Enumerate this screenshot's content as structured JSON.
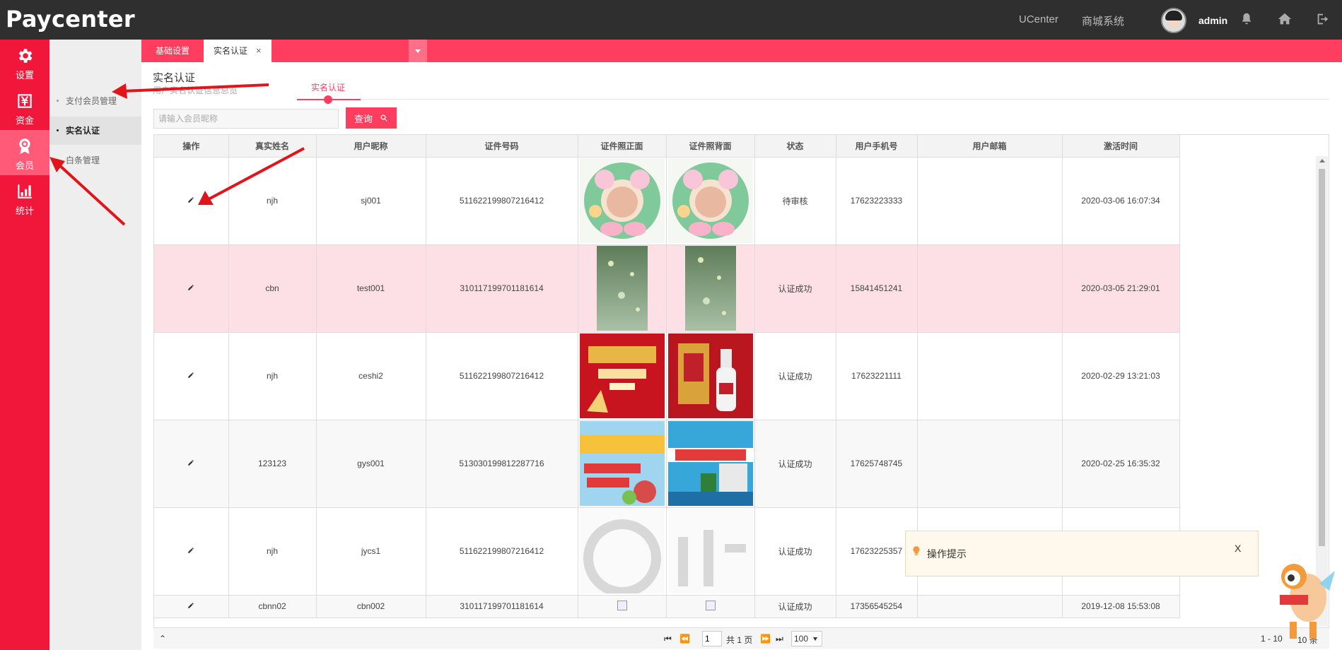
{
  "header": {
    "brand": "Paycenter",
    "links": [
      "UCenter",
      "商城系统"
    ],
    "username": "admin"
  },
  "iconnav": [
    {
      "label": "设置",
      "icon": "gear-icon"
    },
    {
      "label": "资金",
      "icon": "yen-icon"
    },
    {
      "label": "会员",
      "icon": "badge-icon"
    },
    {
      "label": "统计",
      "icon": "chart-icon"
    }
  ],
  "subnav": [
    "支付会员管理",
    "实名认证",
    "白条管理"
  ],
  "tabs": [
    "基础设置",
    "实名认证"
  ],
  "page": {
    "title": "实名认证",
    "subtitle": "用户实名认证信息总览",
    "step": "实名认证"
  },
  "search": {
    "placeholder": "请输入会员昵称",
    "button": "查询"
  },
  "table": {
    "headers": [
      "操作",
      "真实姓名",
      "用户昵称",
      "证件号码",
      "证件照正面",
      "证件照背面",
      "状态",
      "用户手机号",
      "用户邮箱",
      "激活时间"
    ],
    "rows": [
      {
        "name": "njh",
        "nick": "sj001",
        "id": "511622199807216412",
        "status": "待审核",
        "phone": "17623223333",
        "email": "",
        "time": "2020-03-06 16:07:34"
      },
      {
        "name": "cbn",
        "nick": "test001",
        "id": "310117199701181614",
        "status": "认证成功",
        "phone": "15841451241",
        "email": "",
        "time": "2020-03-05 21:29:01"
      },
      {
        "name": "njh",
        "nick": "ceshi2",
        "id": "511622199807216412",
        "status": "认证成功",
        "phone": "17623221111",
        "email": "",
        "time": "2020-02-29 13:21:03"
      },
      {
        "name": "123123",
        "nick": "gys001",
        "id": "513030199812287716",
        "status": "认证成功",
        "phone": "17625748745",
        "email": "",
        "time": "2020-02-25 16:35:32"
      },
      {
        "name": "njh",
        "nick": "jycs1",
        "id": "511622199807216412",
        "status": "认证成功",
        "phone": "17623225357",
        "email": "",
        "time": ""
      },
      {
        "name": "cbnn02",
        "nick": "cbn002",
        "id": "310117199701181614",
        "status": "认证成功",
        "phone": "17356545254",
        "email": "",
        "time": "2019-12-08 15:53:08"
      }
    ]
  },
  "pager": {
    "page": "1",
    "total_pages": "共 1 页",
    "page_size": "100",
    "range": "1 - 10",
    "total": "10 条"
  },
  "toast": {
    "message": "操作提示",
    "close": "X"
  },
  "colors": {
    "accent": "#ff3d5f",
    "nav": "#f0173b",
    "header": "#2f2f2f"
  }
}
